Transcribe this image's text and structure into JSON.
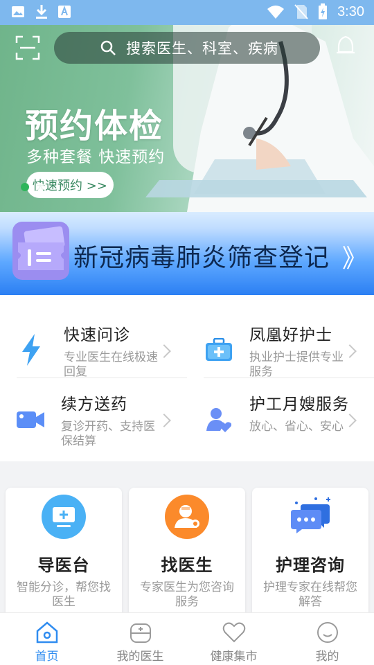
{
  "status_bar": {
    "time": "3:30"
  },
  "search": {
    "placeholder": "搜索医生、科室、疾病"
  },
  "banner": {
    "title": "预约体检",
    "subtitle": "多种套餐 快速预约",
    "cta_label": "快速预约 >>",
    "slides": 2,
    "active_slide": 1
  },
  "covid_banner": {
    "text": "新冠病毒肺炎筛查登记",
    "arrow": "》"
  },
  "services": [
    {
      "title": "快速问诊",
      "desc": "专业医生在线极速回复",
      "icon": "lightning-icon"
    },
    {
      "title": "凤凰好护士",
      "desc": "执业护士提供专业服务",
      "icon": "medical-kit-icon"
    },
    {
      "title": "续方送药",
      "desc": "复诊开药、支持医保结算",
      "icon": "video-camera-icon"
    },
    {
      "title": "护工月嫂服务",
      "desc": "放心、省心、安心",
      "icon": "caregiver-heart-icon"
    }
  ],
  "cards": [
    {
      "title": "导医台",
      "desc": "智能分诊，帮您找医生",
      "icon": "monitor-plus-icon"
    },
    {
      "title": "找医生",
      "desc": "专家医生为您咨询服务",
      "icon": "doctor-icon"
    },
    {
      "title": "护理咨询",
      "desc": "护理专家在线帮您解答",
      "icon": "chat-bubbles-icon"
    }
  ],
  "nav": [
    {
      "label": "首页",
      "icon": "home-icon",
      "active": true
    },
    {
      "label": "我的医生",
      "icon": "medical-bag-icon",
      "active": false
    },
    {
      "label": "健康集市",
      "icon": "heart-icon",
      "active": false
    },
    {
      "label": "我的",
      "icon": "smile-icon",
      "active": false
    }
  ],
  "colors": {
    "accent": "#2f8cf0",
    "status_bar": "#7eb8ee",
    "banner_green": "#6fb48a",
    "covid_blue": "#2b7ff3"
  }
}
